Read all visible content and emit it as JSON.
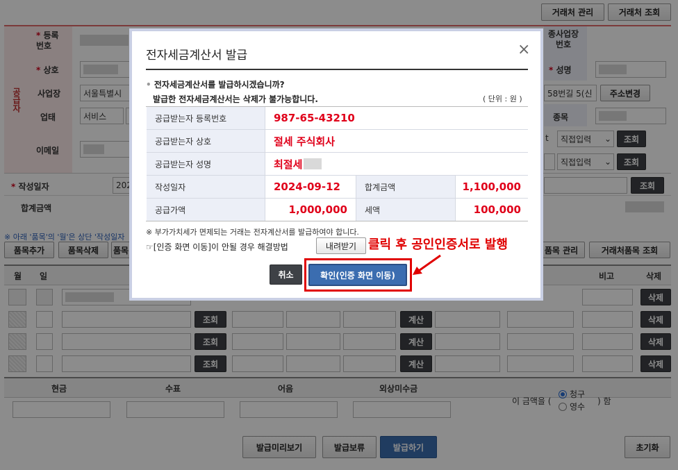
{
  "top_buttons": {
    "partner_manage": "거래처 관리",
    "partner_search": "거래처 조회"
  },
  "supplier_section": {
    "side_label": "공급자",
    "reg_no_label": "등록\n번호",
    "name_label": "상호",
    "address_label": "사업장",
    "address_value": "서울특별시",
    "biz_type_label": "업태",
    "biz_type_value": "서비스",
    "email_label": "이메일",
    "sub_biz_label": "종사업장\n번호",
    "rep_name_label": "성명",
    "address_suffix": "58번길 5(신",
    "address_change_btn": "주소변경",
    "item_label": "종목",
    "direct_input_1": "직접입력",
    "direct_input_2": "직접입력",
    "search_btn": "조회",
    "t_fragment": "t"
  },
  "date_row": {
    "label": "작성일자",
    "value_fragment": "202",
    "search_btn": "조회"
  },
  "total_row": {
    "label": "합계금액"
  },
  "notice_line": "※ 아래 '품목'의 '월'은 상단 '작성일자",
  "item_buttons": {
    "add": "품목추가",
    "delete": "품목삭제",
    "item_fragment": "품목",
    "manage": "품목 관리",
    "partner_item_search": "거래처품목 조회"
  },
  "item_table": {
    "headers": {
      "month": "월",
      "day": "일",
      "remark": "비고",
      "delete": "삭제"
    },
    "row_buttons": {
      "search": "조회",
      "calc": "계산",
      "delete": "삭제"
    }
  },
  "payment": {
    "headers": [
      "현금",
      "수표",
      "어음",
      "외상미수금"
    ],
    "amount_prefix": "이 금액을 (",
    "amount_suffix": ") 함",
    "options": [
      "청구",
      "영수"
    ]
  },
  "bottom_buttons": {
    "preview": "발급미리보기",
    "hold": "발급보류",
    "issue": "발급하기",
    "reset": "초기화"
  },
  "modal": {
    "title": "전자세금계산서 발급",
    "close": "×",
    "question": "전자세금계산서를 발급하시겠습니까?",
    "warning": "발급한 전자세금계산서는 삭제가 불가능합니다.",
    "unit": "( 단위 : 원 )",
    "rows": {
      "reg_no_label": "공급받는자 등록번호",
      "reg_no_value": "987-65-43210",
      "name_label": "공급받는자 상호",
      "name_value": "절세 주식회사",
      "rep_label": "공급받는자 성명",
      "rep_value": "최절세",
      "date_label": "작성일자",
      "date_value": "2024-09-12",
      "total_label": "합계금액",
      "total_value": "1,100,000",
      "supply_label": "공급가액",
      "supply_value": "1,000,000",
      "tax_label": "세액",
      "tax_value": "100,000"
    },
    "vat_notice": "※ 부가가치세가 면제되는 거래는 전자계산서를 발급하여야 합니다.",
    "cert_help": "☞[인증 화면 이동]이 안될 경우 해결방법",
    "download_btn": "내려받기",
    "cancel_btn": "취소",
    "confirm_btn": "확인(인증 화면 이동)"
  },
  "annotation": {
    "text": "클릭 후 공인인증서로 발행",
    "color": "#e00000"
  }
}
